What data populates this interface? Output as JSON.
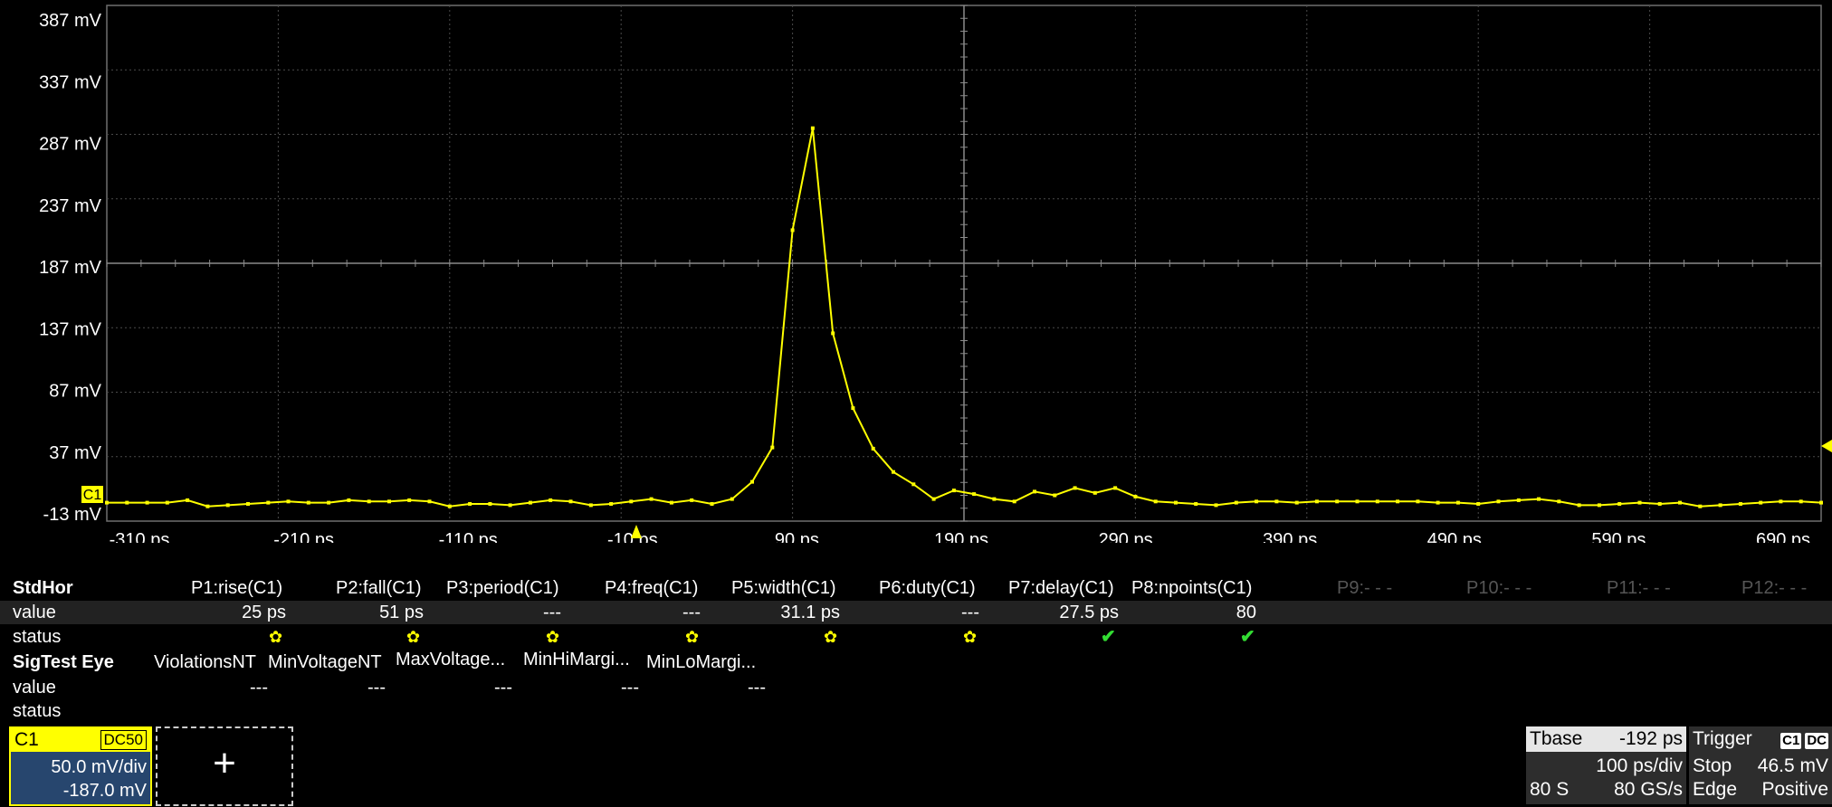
{
  "waveform": {
    "channel_marker": "C1",
    "y_labels": [
      "387 mV",
      "337 mV",
      "287 mV",
      "237 mV",
      "187 mV",
      "137 mV",
      "87 mV",
      "37 mV",
      "-13 mV"
    ],
    "x_labels": [
      "-310 ps",
      "-210 ps",
      "-110 ps",
      "-10 ps",
      "90 ps",
      "190 ps",
      "290 ps",
      "390 ps",
      "490 ps",
      "590 ps",
      "690 ps"
    ],
    "trace_color": "#ffff00",
    "points_mv": [
      -5,
      -5,
      -5,
      -5,
      -3,
      -8,
      -7,
      -6,
      -5,
      -4,
      -5,
      -5,
      -3,
      -4,
      -4,
      -3,
      -4,
      -8,
      -6,
      -6,
      -7,
      -5,
      -3,
      -4,
      -7,
      -6,
      -4,
      -2,
      -5,
      -3,
      -6,
      -2,
      12,
      40,
      217,
      300,
      133,
      72,
      39,
      20,
      10,
      -2,
      5,
      2,
      -2,
      -4,
      4,
      1,
      7,
      3,
      7,
      0,
      -4,
      -5,
      -6,
      -7,
      -5,
      -4,
      -4,
      -5,
      -4,
      -4,
      -4,
      -4,
      -4,
      -4,
      -5,
      -5,
      -6,
      -4,
      -3,
      -2,
      -4,
      -7,
      -7,
      -6,
      -5,
      -6,
      -5,
      -8,
      -7,
      -6,
      -5,
      -4,
      -4,
      -5
    ]
  },
  "measurements": {
    "row1_title": "StdHor",
    "row1_params": [
      "P1:rise(C1)",
      "P2:fall(C1)",
      "P3:period(C1)",
      "P4:freq(C1)",
      "P5:width(C1)",
      "P6:duty(C1)",
      "P7:delay(C1)",
      "P8:npoints(C1)",
      "P9:- - -",
      "P10:- - -",
      "P11:- - -",
      "P12:- - -"
    ],
    "value_label": "value",
    "status_label": "status",
    "row1_values": [
      "25 ps",
      "51 ps",
      "---",
      "---",
      "31.1 ps",
      "---",
      "27.5 ps",
      "80"
    ],
    "row1_status": [
      "x",
      "x",
      "x",
      "x",
      "x",
      "x",
      "ok",
      "ok"
    ],
    "row2_title": "SigTest Eye",
    "row2_params": [
      "ViolationsNT",
      "MinVoltageNT",
      "MaxVoltage...",
      "MinHiMargi...",
      "MinLoMargi..."
    ],
    "row2_values": [
      "---",
      "---",
      "---",
      "---",
      "---"
    ]
  },
  "channel": {
    "name": "C1",
    "coupling": "DC50",
    "vdiv": "50.0 mV/div",
    "offset": "-187.0 mV"
  },
  "add_button": "+",
  "timebase": {
    "label": "Tbase",
    "delay": "-192 ps",
    "tdiv": "100 ps/div",
    "samples": "80 S",
    "rate": "80 GS/s"
  },
  "trigger": {
    "label": "Trigger",
    "source_tag": "C1",
    "coupling_tag": "DC",
    "mode": "Stop",
    "level": "46.5 mV",
    "type": "Edge",
    "slope": "Positive"
  },
  "colors": {
    "trace": "#ffff00",
    "channel_bg": "#27466e",
    "ok": "#33dd33"
  }
}
